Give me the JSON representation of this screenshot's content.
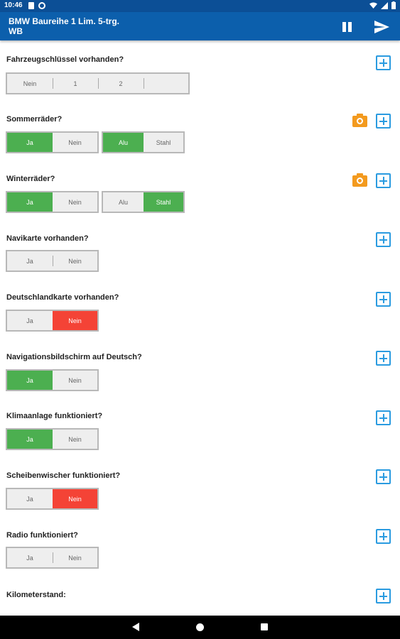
{
  "status_bar": {
    "time": "10:46"
  },
  "app_bar": {
    "title": "BMW Baureihe 1 Lim. 5-trg.",
    "subtitle": "WB"
  },
  "questions": [
    {
      "label": "Fahrzeugschlüssel vorhanden?",
      "options": [
        "Nein",
        "1",
        "2",
        ""
      ]
    },
    {
      "label": "Sommerräder?",
      "options": [
        "Ja",
        "Nein"
      ],
      "options2": [
        "Alu",
        "Stahl"
      ]
    },
    {
      "label": "Winterräder?",
      "options": [
        "Ja",
        "Nein"
      ],
      "options2": [
        "Alu",
        "Stahl"
      ]
    },
    {
      "label": "Navikarte vorhanden?",
      "options": [
        "Ja",
        "Nein"
      ]
    },
    {
      "label": "Deutschlandkarte vorhanden?",
      "options": [
        "Ja",
        "Nein"
      ]
    },
    {
      "label": "Navigationsbildschirm auf Deutsch?",
      "options": [
        "Ja",
        "Nein"
      ]
    },
    {
      "label": "Klimaanlage funktioniert?",
      "options": [
        "Ja",
        "Nein"
      ]
    },
    {
      "label": "Scheibenwischer funktioniert?",
      "options": [
        "Ja",
        "Nein"
      ]
    },
    {
      "label": "Radio funktioniert?",
      "options": [
        "Ja",
        "Nein"
      ]
    },
    {
      "label": "Kilometerstand:"
    }
  ],
  "colors": {
    "app_bar": "#0c5fac",
    "status_bar": "#0c4f96",
    "selected_green": "#4caf50",
    "selected_red": "#f44336",
    "add_icon": "#2a9be0",
    "camera_icon": "#f39a1e"
  },
  "icons": {
    "pause": "pause-icon",
    "send": "send-icon",
    "add": "add-box-icon",
    "camera": "camera-icon"
  }
}
